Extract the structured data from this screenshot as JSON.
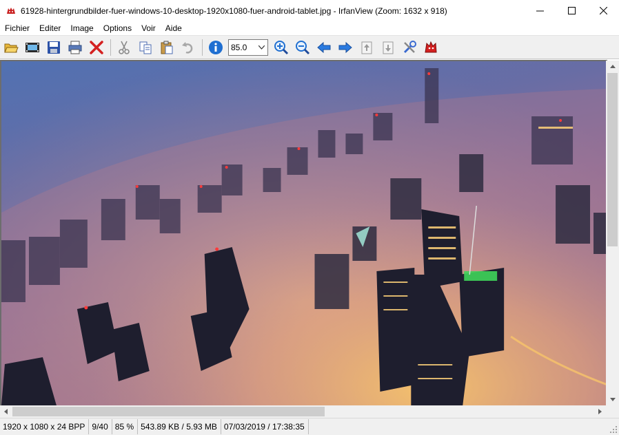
{
  "window": {
    "title": "61928-hintergrundbilder-fuer-windows-10-desktop-1920x1080-fuer-android-tablet.jpg - IrfanView (Zoom: 1632 x 918)",
    "app_icon": "irfanview-cat-icon",
    "controls": [
      "minimize-icon",
      "maximize-icon",
      "close-icon"
    ]
  },
  "menu": {
    "items": [
      {
        "label": "Fichier"
      },
      {
        "label": "Editer"
      },
      {
        "label": "Image"
      },
      {
        "label": "Options"
      },
      {
        "label": "Voir"
      },
      {
        "label": "Aide"
      }
    ]
  },
  "toolbar": {
    "icons": [
      "open-folder-icon",
      "slideshow-icon",
      "save-icon",
      "print-icon",
      "delete-icon",
      "cut-icon",
      "copy-icon",
      "paste-icon",
      "undo-icon",
      "info-icon",
      "zoom-in-icon",
      "zoom-out-icon",
      "previous-icon",
      "next-icon",
      "page-up-icon",
      "page-down-icon",
      "settings-icon",
      "about-icon"
    ],
    "zoom_value": "85.0"
  },
  "viewer": {
    "image_icon": "city-fog-photo"
  },
  "status": {
    "dimensions": "1920 x 1080 x 24 BPP",
    "index": "9/40",
    "zoom": "85 %",
    "size": "543.89 KB / 5.93 MB",
    "datetime": "07/03/2019 / 17:38:35"
  },
  "colors": {
    "accent_blue": "#1f6fd1",
    "delete_red": "#d42020",
    "sky_top": "#3d6fb8",
    "fog_warm": "#e6a57a"
  }
}
